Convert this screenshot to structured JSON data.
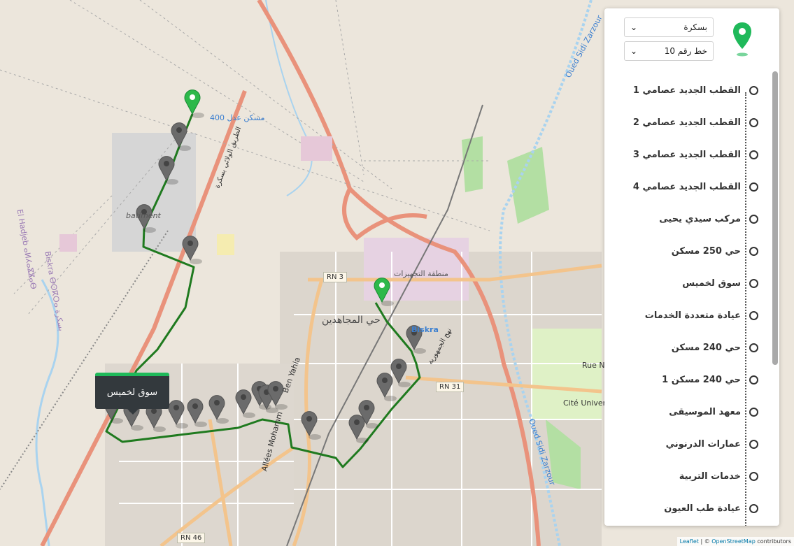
{
  "panel": {
    "city_select": "بسكرة",
    "line_select": "خط رقم 10",
    "stops": [
      "القطب الجديد عصامي 1",
      "القطب الجديد عصامي 2",
      "القطب الجديد عصامي 3",
      "القطب الجديد عصامي 4",
      "مركب سيدي يحيى",
      "حي 250 مسكن",
      "سوق لخميس",
      "عيادة متعددة الخدمات",
      "حي 240 مسكن",
      "حي 240 مسكن 1",
      "معهد الموسيقى",
      "عمارات الدرنوني",
      "خدمات التربية",
      "عيادة طب العيون"
    ]
  },
  "tooltip": {
    "text": "سوق لخميس"
  },
  "map": {
    "labels": {
      "adl": "400 مسكن عدل",
      "batiment": "batiment",
      "equipment_zone": "منطقة التجهيزات",
      "hay_moudjahidine": "حي المجاهدين",
      "biskra": "Biskra",
      "wadi_zarzour_top": "Oued Sidi Zarzour",
      "wadi_zarzour_bottom": "Oued Sidi Zarzour",
      "cite_universitaire": "Cité Universitaire",
      "rue_n": "Rue N",
      "ben_yahia": "Ben Yahia",
      "allees_mohammed": "Allées Mohamm",
      "el_hadjeb": "El Hadjeb ⴰⵍⵃⴰⴵⴵⴰⴱ",
      "biskra_tif": "Biskra ⴱⵙⴽⵔⴰ بسكرة",
      "road_tarik_taslisi": "الطريق الولائي بسكرة",
      "road_ahd": "نهج الجمهورية"
    },
    "shields": [
      "RN 3",
      "RN 31",
      "RN 46"
    ]
  },
  "attribution": {
    "leaflet": "Leaflet",
    "sep": " | © ",
    "osm": "OpenStreetMap",
    "rest": " contributors"
  },
  "colors": {
    "route": "#1f7a1f",
    "marker_active": "#2db84a",
    "marker": "#6b6b6b",
    "accent": "#1fb95a"
  }
}
